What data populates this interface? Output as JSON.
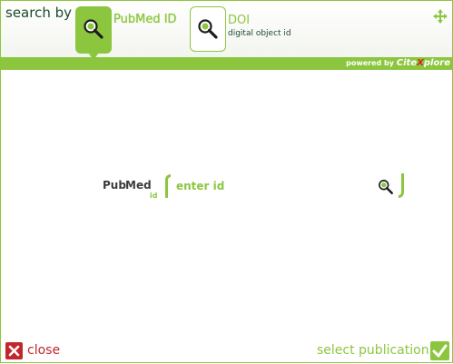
{
  "header": {
    "search_by_label": "search by",
    "tabs": [
      {
        "label": "PubMed ID",
        "sublabel": "",
        "selected": true,
        "icon": "magnifier-icon"
      },
      {
        "label": "DOI",
        "sublabel": "digital object id",
        "selected": false,
        "icon": "magnifier-icon"
      }
    ],
    "move_icon": "move-arrows-icon",
    "powered_by": "powered by",
    "brand_prefix": "Cite",
    "brand_x": "X",
    "brand_suffix": "plore"
  },
  "search": {
    "logo_pub": "Pub",
    "logo_med": "Med",
    "logo_id": "id",
    "placeholder": "enter id",
    "value": "",
    "button_icon": "search-icon"
  },
  "footer": {
    "close_label": "close",
    "select_label": "select publication",
    "close_icon": "close-icon",
    "select_icon": "checkmark-icon"
  },
  "colors": {
    "accent": "#8cc63f",
    "dark_green": "#1c4a2c",
    "danger": "#c1272d"
  }
}
